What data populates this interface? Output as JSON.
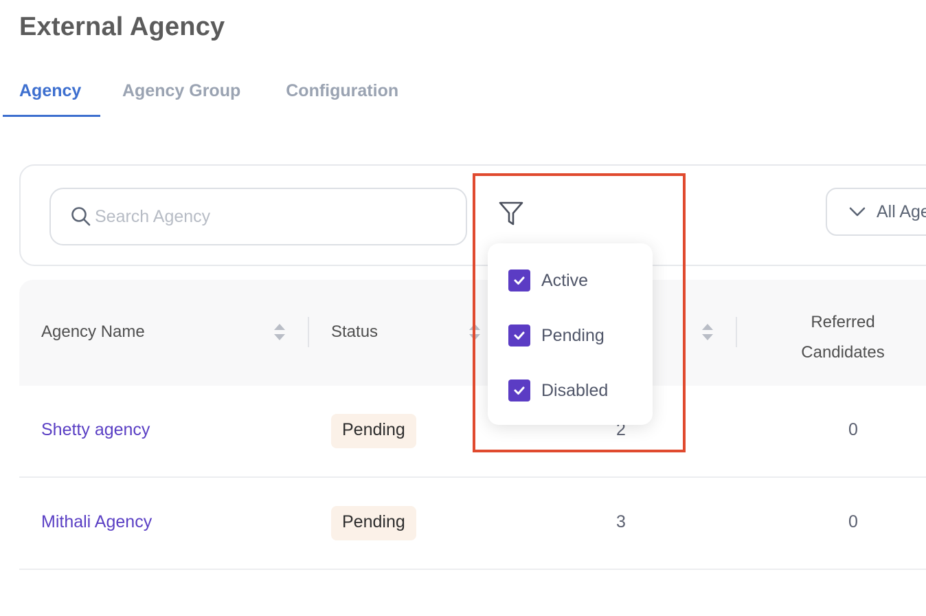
{
  "page": {
    "title": "External Agency"
  },
  "tabs": [
    {
      "label": "Agency",
      "active": true
    },
    {
      "label": "Agency Group",
      "active": false
    },
    {
      "label": "Configuration",
      "active": false
    }
  ],
  "toolbar": {
    "search": {
      "placeholder": "Search Agency",
      "value": ""
    },
    "agency_select": {
      "label": "All Age"
    }
  },
  "status_filter": {
    "options": [
      {
        "label": "Active",
        "checked": true
      },
      {
        "label": "Pending",
        "checked": true
      },
      {
        "label": "Disabled",
        "checked": true
      }
    ]
  },
  "table": {
    "columns": {
      "name": "Agency Name",
      "status": "Status",
      "referred": "Referred Candidates"
    },
    "rows": [
      {
        "name": "Shetty agency",
        "status": "Pending",
        "count": "2",
        "referred": "0"
      },
      {
        "name": "Mithali Agency",
        "status": "Pending",
        "count": "3",
        "referred": "0"
      }
    ]
  },
  "colors": {
    "active_tab": "#3d6fcf",
    "link": "#5a3fc4",
    "checkbox": "#5b3cc4",
    "pending_badge_bg": "#fbf1e8",
    "highlight_border": "#e04a2f"
  }
}
